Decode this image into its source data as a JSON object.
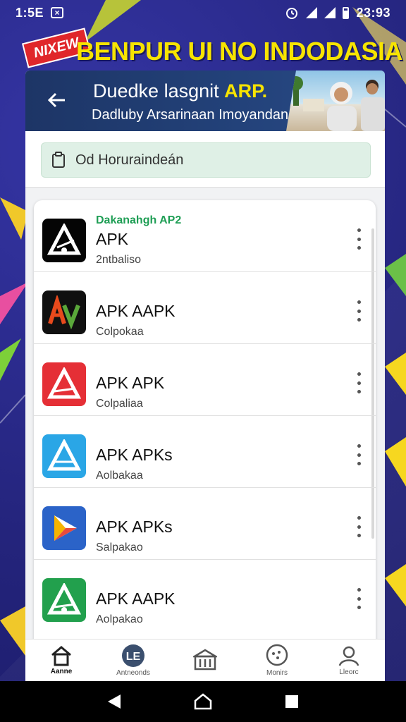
{
  "status_bar": {
    "time": "1:5E",
    "right_time": "23:93"
  },
  "banner": {
    "ribbon": "NIXEW",
    "title": "BENPUR UI NO INDODASIA"
  },
  "header": {
    "title_main": "Duedke lasgnit ",
    "title_accent": "ARP.",
    "subtitle": "Dadluby Arsarinaan Imoyandan"
  },
  "search": {
    "value": "Od Horuraindeán"
  },
  "apps": {
    "section_label": "Dakanahgh AP2",
    "items": [
      {
        "name": "APK",
        "sub": "2ntbaliso",
        "icon": "apk-triangle-black-icon",
        "bg": "#050505"
      },
      {
        "name": "APK AAPK",
        "sub": "Colpokaa",
        "icon": "av-logo-icon",
        "bg": "#101010"
      },
      {
        "name": "APK APK",
        "sub": "Colpaliaa",
        "icon": "apk-triangle-red-icon",
        "bg": "#e52f36"
      },
      {
        "name": "APK APKs",
        "sub": "Aolbakaa",
        "icon": "apk-triangle-blue-icon",
        "bg": "#2aa6e6"
      },
      {
        "name": "APK APKs",
        "sub": "Salpakao",
        "icon": "play-store-icon",
        "bg": "#2b63c8"
      },
      {
        "name": "APK AAPK",
        "sub": "Aolpakao",
        "icon": "apk-triangle-green-icon",
        "bg": "#22a04d"
      }
    ]
  },
  "bottom_nav": [
    {
      "label": "Aanne",
      "icon": "home-icon"
    },
    {
      "label": "Antneonds",
      "icon": "apps-badge-icon"
    },
    {
      "label": "",
      "icon": "bank-icon"
    },
    {
      "label": "Monirs",
      "icon": "chat-bubble-icon"
    },
    {
      "label": "Lleorc",
      "icon": "profile-icon"
    }
  ],
  "colors": {
    "banner_yellow": "#f7e400",
    "accent_green": "#1f9e55",
    "header_blue": "#1d3566"
  }
}
